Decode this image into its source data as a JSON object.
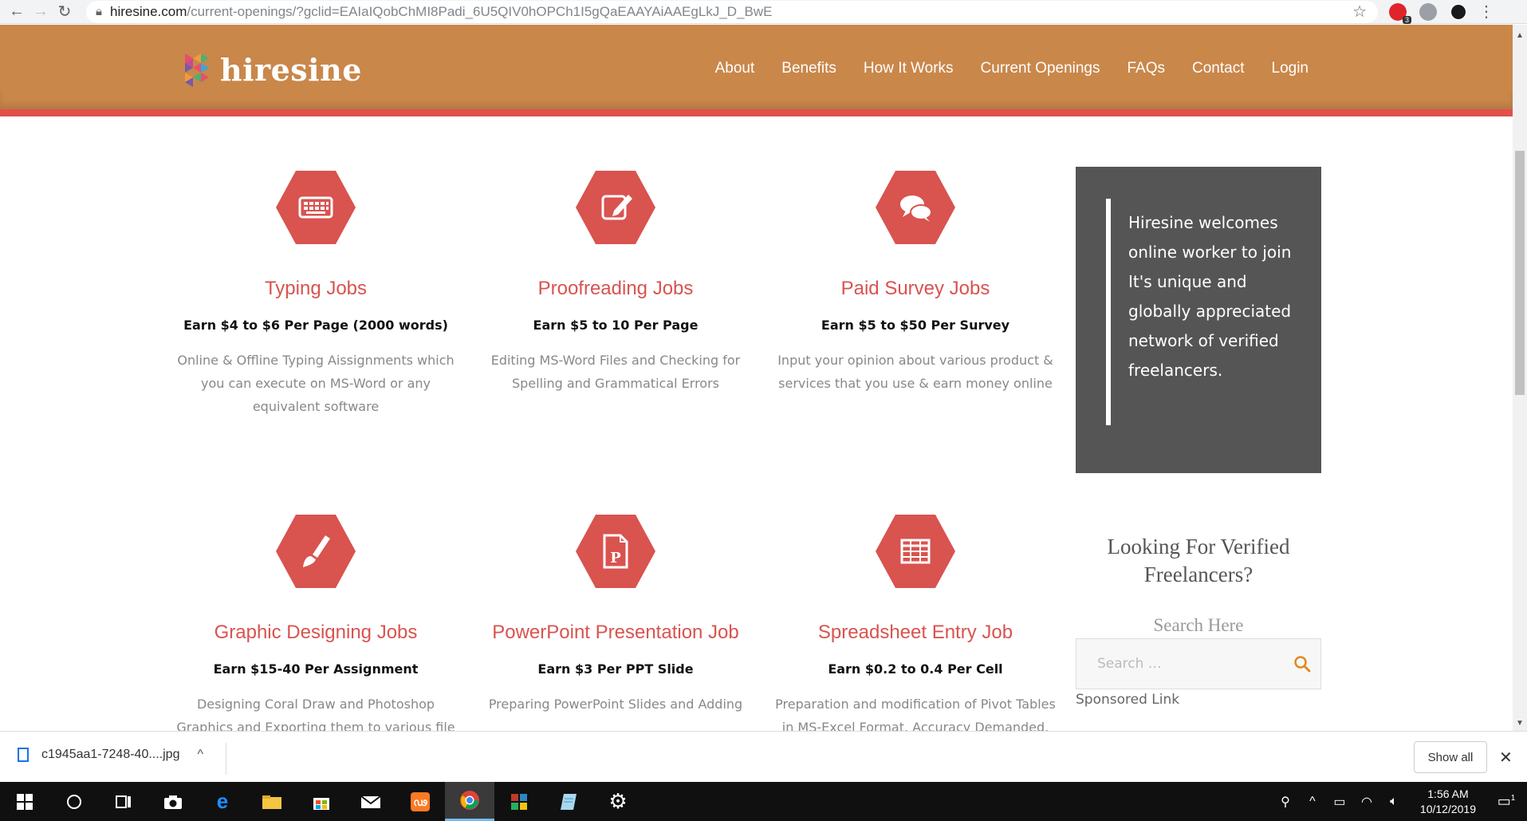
{
  "browser": {
    "url_host": "hiresine.com",
    "url_path": "/current-openings/?gclid=EAIaIQobChMI8Padi_6U5QIV0hOPCh1I5gQaEAAYAiAAEgLkJ_D_BwE",
    "ext_badge": "3"
  },
  "site": {
    "logo_text": "hiresine",
    "nav": [
      "About",
      "Benefits",
      "How It Works",
      "Current Openings",
      "FAQs",
      "Contact",
      "Login"
    ],
    "brand_colors": {
      "header": "#c9874a",
      "accent": "#d9534f",
      "red_strip": "#e0504a"
    }
  },
  "jobs": [
    {
      "icon": "keyboard-icon",
      "title": "Typing Jobs",
      "earn": "Earn $4 to $6 Per Page (2000 words)",
      "desc": "Online & Offline Typing Aissignments which you can execute on MS-Word or any equivalent software"
    },
    {
      "icon": "edit-icon",
      "title": "Proofreading Jobs",
      "earn": "Earn $5 to 10 Per Page",
      "desc": "Editing MS-Word Files and Checking for Spelling and Grammatical Errors"
    },
    {
      "icon": "chat-bubbles-icon",
      "title": "Paid Survey Jobs",
      "earn": "Earn $5 to $50 Per Survey",
      "desc": "Input your opinion about various product & services that you use & earn money online"
    },
    {
      "icon": "paintbrush-icon",
      "title": "Graphic Designing Jobs",
      "earn": "Earn $15-40 Per Assignment",
      "desc": "Designing Coral Draw and Photoshop Graphics and Exporting them to various file"
    },
    {
      "icon": "powerpoint-file-icon",
      "title": "PowerPoint Presentation Job",
      "earn": "Earn $3 Per PPT Slide",
      "desc": "Preparing PowerPoint Slides and Adding"
    },
    {
      "icon": "spreadsheet-icon",
      "title": "Spreadsheet Entry Job",
      "earn": "Earn $0.2 to 0.4 Per Cell",
      "desc": "Preparation and modification of Pivot Tables in MS-Excel Format. Accuracy Demanded."
    }
  ],
  "sidebar": {
    "quote": "Hiresine welcomes online worker to join It's unique and globally appreciated network of verified freelancers.",
    "looking": "Looking For Verified Freelancers?",
    "search_heading": "Search Here",
    "search_placeholder": "Search …",
    "sponsored": "Sponsored Link"
  },
  "download_bar": {
    "filename": "c1945aa1-7248-40....jpg",
    "show_all": "Show all"
  },
  "taskbar": {
    "time": "1:56 AM",
    "date": "10/12/2019",
    "notification_count": "1"
  }
}
